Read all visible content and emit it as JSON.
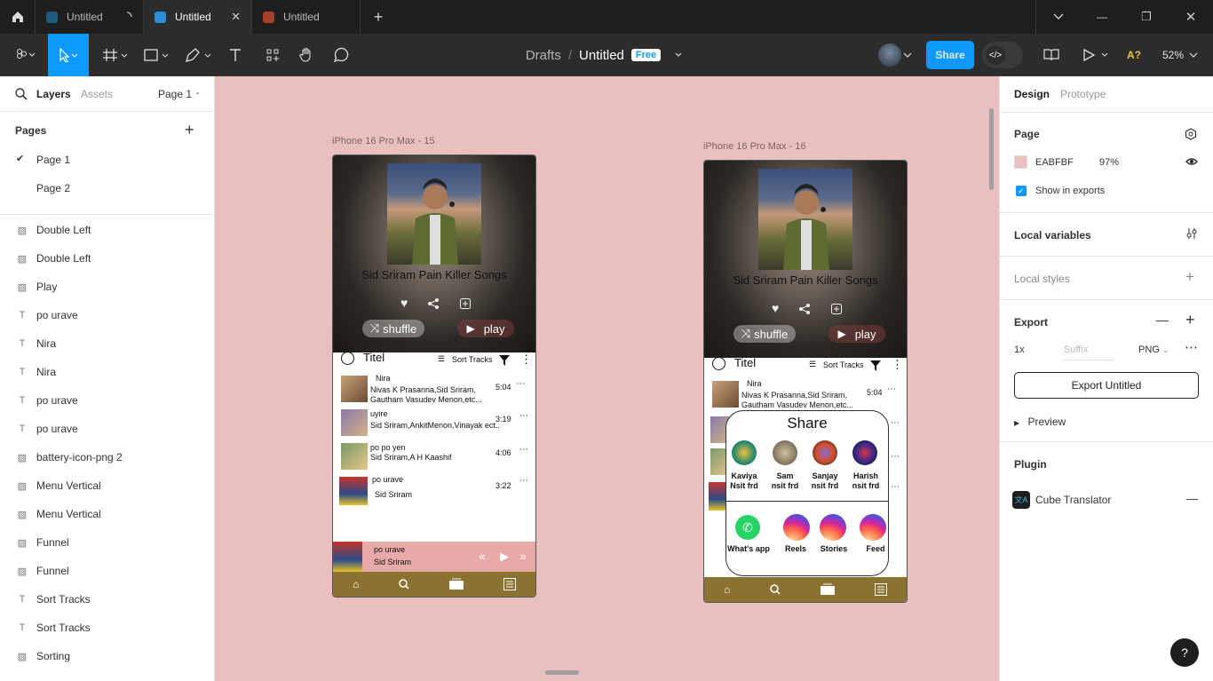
{
  "tabs": [
    {
      "label": "Untitled",
      "color": "#1e5a7a"
    },
    {
      "label": "Untitled",
      "color": "#2a8fd8"
    },
    {
      "label": "Untitled",
      "color": "#a3412a"
    }
  ],
  "breadcrumb": {
    "drafts": "Drafts",
    "separator": "/",
    "title": "Untitled",
    "badge": "Free"
  },
  "toolbar": {
    "share": "Share",
    "zoom": "52%",
    "ai_label": "A?"
  },
  "left": {
    "tab_layers": "Layers",
    "tab_assets": "Assets",
    "page_selector": "Page 1",
    "pages_heading": "Pages",
    "pages": [
      {
        "label": "Page 1",
        "selected": true
      },
      {
        "label": "Page 2",
        "selected": false
      }
    ],
    "layers": [
      {
        "type": "img",
        "label": "Double Left"
      },
      {
        "type": "img",
        "label": "Double Left"
      },
      {
        "type": "img",
        "label": "Play"
      },
      {
        "type": "T",
        "label": "po urave"
      },
      {
        "type": "T",
        "label": "Nira"
      },
      {
        "type": "T",
        "label": "Nira"
      },
      {
        "type": "T",
        "label": "po urave"
      },
      {
        "type": "T",
        "label": "po urave"
      },
      {
        "type": "img",
        "label": "battery-icon-png 2"
      },
      {
        "type": "img",
        "label": "Menu Vertical"
      },
      {
        "type": "img",
        "label": "Menu Vertical"
      },
      {
        "type": "img",
        "label": "Funnel"
      },
      {
        "type": "img",
        "label": "Funnel"
      },
      {
        "type": "T",
        "label": "Sort Tracks"
      },
      {
        "type": "T",
        "label": "Sort Tracks"
      },
      {
        "type": "img",
        "label": "Sorting"
      }
    ]
  },
  "right": {
    "tab_design": "Design",
    "tab_prototype": "Prototype",
    "page_heading": "Page",
    "page_color_hex": "EABFBF",
    "page_opacity": "97%",
    "page_color": "#EABFBF",
    "show_in_exports": "Show in exports",
    "local_variables": "Local variables",
    "local_styles": "Local styles",
    "export_heading": "Export",
    "export_scale": "1x",
    "export_suffix_placeholder": "Suffix",
    "export_format": "PNG",
    "export_button": "Export Untitled",
    "preview": "Preview",
    "plugin_heading": "Plugin",
    "plugin_name": "Cube Translator"
  },
  "frames": [
    {
      "label": "iPhone 16 Pro Max - 15",
      "song_title": "Sid Sriram Pain Killer Songs",
      "shuffle": "shuffle",
      "play": "play",
      "list_title": "Titel",
      "sort": "Sort Tracks",
      "tracks": [
        {
          "title": "Nira",
          "artist": "Nivas K Prasanna,Sid Sriram,",
          "artist2": "Gautham Vasudev Menon,etc...",
          "time": "5:04"
        },
        {
          "title": "uyire",
          "artist": "Sid Sriram,AnkitMenon,Vinayak ect..",
          "artist2": "",
          "time": "3:19"
        },
        {
          "title": "po po yen",
          "artist": "Sid Sriram,A H Kaashif",
          "artist2": "",
          "time": "4:06"
        },
        {
          "title": "po urave",
          "artist": "Sid Sriram",
          "artist2": "",
          "time": "3:22"
        }
      ],
      "mini_title": "po urave",
      "mini_artist": "Sid Sriram"
    },
    {
      "label": "iPhone 16 Pro Max - 16",
      "song_title": "Sid Sriram Pain Killer Songs",
      "shuffle": "shuffle",
      "play": "play",
      "list_title": "Titel",
      "sort": "Sort Tracks",
      "tracks": [
        {
          "title": "Nira",
          "artist": "Nivas K Prasanna,Sid Sriram,",
          "artist2": "Gautham Vasudev Menon,etc...",
          "time": "5:04"
        }
      ],
      "share": {
        "title": "Share",
        "contacts": [
          {
            "name": "Kaviya",
            "sub": "Nsit frd"
          },
          {
            "name": "Sam",
            "sub": "nsit frd"
          },
          {
            "name": "Sanjay",
            "sub": "nsit frd"
          },
          {
            "name": "Harish",
            "sub": "nsit frd"
          }
        ],
        "apps": [
          "What's app",
          "Reels",
          "Stories",
          "Feed"
        ]
      }
    }
  ]
}
